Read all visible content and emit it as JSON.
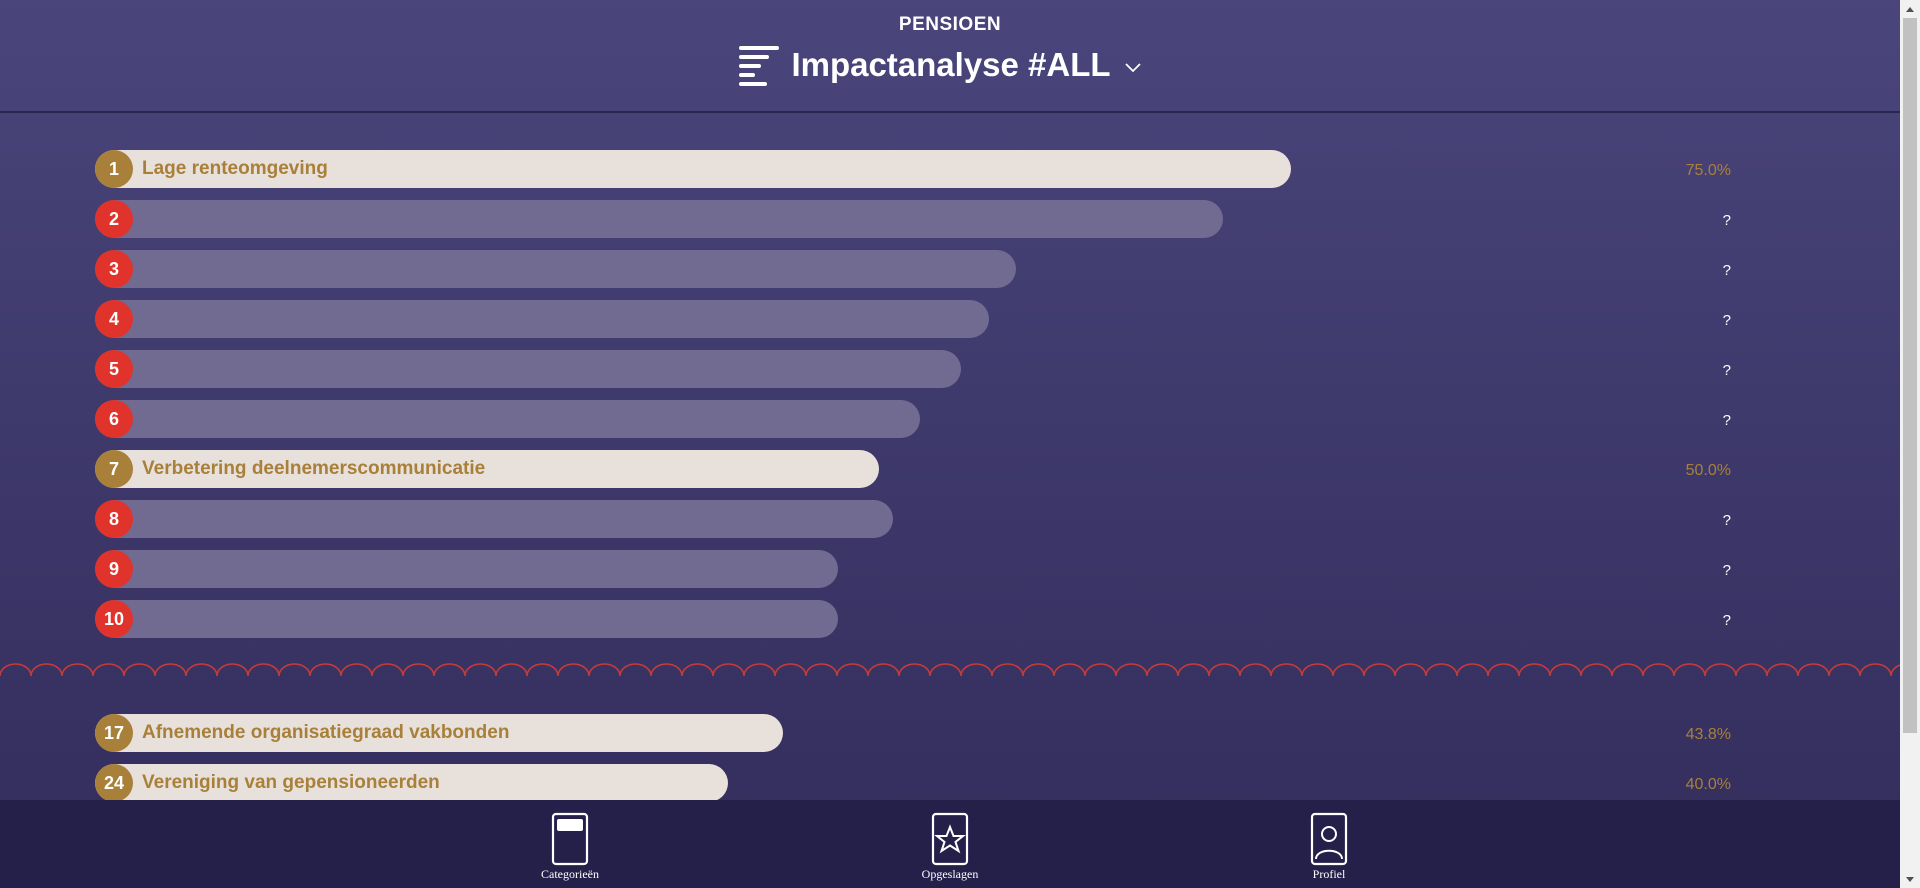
{
  "header": {
    "brand": "PENSIOEN",
    "title": "Impactanalyse #ALL"
  },
  "ranking": [
    {
      "rank": "1",
      "label": "Lage renteomgeving",
      "value": "75.0%",
      "known": true,
      "level": 0.87
    },
    {
      "rank": "2",
      "label": "",
      "value": "?",
      "known": false,
      "level": 0.82
    },
    {
      "rank": "3",
      "label": "",
      "value": "?",
      "known": false,
      "level": 0.67
    },
    {
      "rank": "4",
      "label": "",
      "value": "?",
      "known": false,
      "level": 0.65
    },
    {
      "rank": "5",
      "label": "",
      "value": "?",
      "known": false,
      "level": 0.63
    },
    {
      "rank": "6",
      "label": "",
      "value": "?",
      "known": false,
      "level": 0.6
    },
    {
      "rank": "7",
      "label": "Verbetering deelnemerscommunicatie",
      "value": "50.0%",
      "known": true,
      "level": 0.57
    },
    {
      "rank": "8",
      "label": "",
      "value": "?",
      "known": false,
      "level": 0.58
    },
    {
      "rank": "9",
      "label": "",
      "value": "?",
      "known": false,
      "level": 0.54
    },
    {
      "rank": "10",
      "label": "",
      "value": "?",
      "known": false,
      "level": 0.54
    }
  ],
  "ranking_more": [
    {
      "rank": "17",
      "label": "Afnemende organisatiegraad vakbonden",
      "value": "43.8%",
      "known": true,
      "level": 0.5
    },
    {
      "rank": "24",
      "label": "Vereniging van gepensioneerden",
      "value": "40.0%",
      "known": true,
      "level": 0.46
    }
  ],
  "nav": {
    "categories": "Categorieën",
    "saved": "Opgeslagen",
    "profile": "Profiel"
  },
  "colors": {
    "gold": "#a8803a",
    "red": "#e0332b",
    "known_bar": "#e8e0da",
    "unknown_bar": "#716b91"
  }
}
